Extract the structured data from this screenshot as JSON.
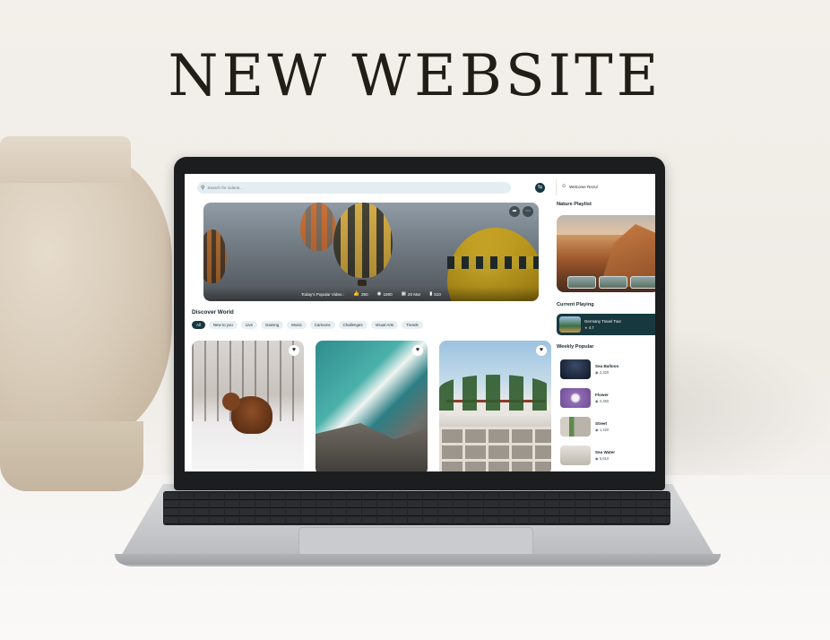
{
  "headline": "NEW WEBSITE",
  "site": {
    "search": {
      "placeholder": "Search for videos...",
      "icon": "search-icon"
    },
    "user": {
      "welcome": "Welcome Rezul",
      "icon": "user-icon"
    },
    "hero": {
      "title": "Today's Popular Video :",
      "likes": "250",
      "views": "1900",
      "date": "20 Mar",
      "saves": "510"
    },
    "discover": {
      "title": "Discover World",
      "chips": [
        "All",
        "New to you",
        "Live",
        "Gaming",
        "Music",
        "Cartoons",
        "Challenges",
        "Visual Arts",
        "Trends"
      ],
      "active_chip": "All"
    },
    "nature_playlist": {
      "title": "Nature Playlist"
    },
    "current_playing": {
      "title": "Current Playing",
      "video": "Germany Travel Tour",
      "rating": "4.7"
    },
    "weekly_popular": {
      "title": "Weekly Popular",
      "items": [
        {
          "name": "Sea Balloon",
          "views": "2,320"
        },
        {
          "name": "Flower",
          "views": "2,450"
        },
        {
          "name": "Street",
          "views": "1,420"
        },
        {
          "name": "Sea Water",
          "views": "5,610"
        }
      ]
    },
    "colors": {
      "accent": "#17383f",
      "chip_bg": "#e7eff2",
      "search_bg": "#e4eef2"
    }
  }
}
